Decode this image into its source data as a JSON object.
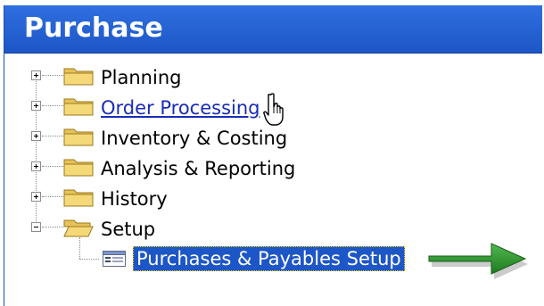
{
  "window": {
    "title": "Purchase"
  },
  "tree": {
    "items": [
      {
        "label": "Planning",
        "state": "collapsed"
      },
      {
        "label": "Order Processing",
        "state": "collapsed",
        "hovered": true
      },
      {
        "label": "Inventory & Costing",
        "state": "collapsed"
      },
      {
        "label": "Analysis & Reporting",
        "state": "collapsed"
      },
      {
        "label": "History",
        "state": "collapsed"
      },
      {
        "label": "Setup",
        "state": "expanded",
        "children": [
          {
            "label": "Purchases & Payables Setup",
            "selected": true
          }
        ]
      }
    ]
  },
  "colors": {
    "title_bar": "#1d56c6",
    "selection": "#1d56c6",
    "link": "#1a2bb8",
    "arrow": "#2e8b2e"
  },
  "icons": {
    "expander_collapsed": "plus-box-icon",
    "expander_expanded": "minus-box-icon",
    "folder_closed": "folder-icon",
    "folder_open": "open-folder-icon",
    "form": "form-icon",
    "cursor": "hand-pointer-icon",
    "arrow": "green-arrow-icon"
  }
}
